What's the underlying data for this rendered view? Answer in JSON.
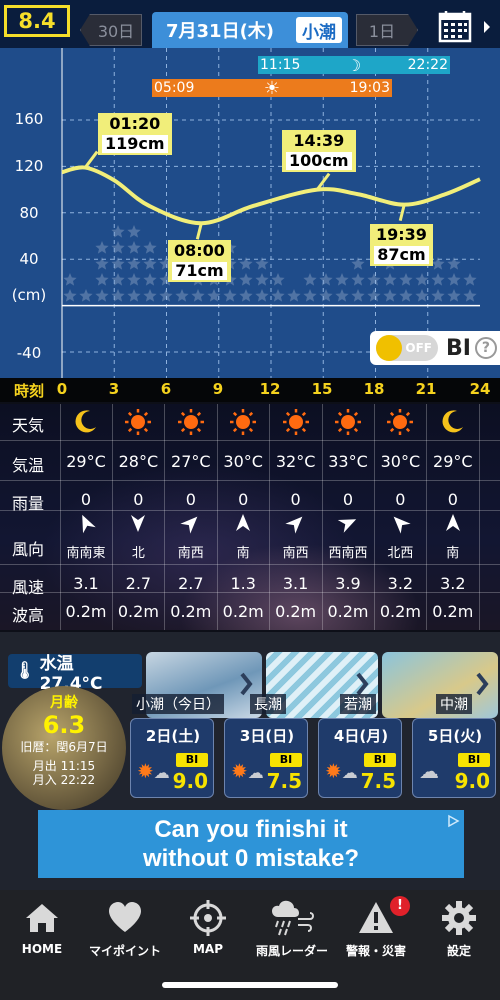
{
  "header": {
    "score_badge": "8.4",
    "prev_label": "30日",
    "date": "7月31日(木)",
    "tide_type": "小潮",
    "next_label": "1日"
  },
  "chart": {
    "moon_bar": {
      "rise": "11:15",
      "set": "22:22"
    },
    "sun_bar": {
      "rise": "05:09",
      "set": "19:03"
    },
    "yticks": [
      "160",
      "120",
      "80",
      "40",
      "(cm)",
      "-40"
    ],
    "callouts": [
      {
        "time": "01:20",
        "height": "119cm"
      },
      {
        "time": "08:00",
        "height": "71cm"
      },
      {
        "time": "14:39",
        "height": "100cm"
      },
      {
        "time": "19:39",
        "height": "87cm"
      }
    ],
    "bi_switch": "OFF",
    "bi_label": "BI",
    "help_glyph": "?"
  },
  "chart_data": {
    "type": "line",
    "title": "",
    "xlabel": "時刻",
    "ylabel": "(cm)",
    "x": [
      0,
      1.33,
      3,
      5,
      8,
      11,
      14.65,
      17,
      19.65,
      22,
      24
    ],
    "series": [
      {
        "values": [
          115,
          119,
          108,
          86,
          71,
          86,
          100,
          96,
          87,
          96,
          109
        ]
      }
    ],
    "xlim": [
      0,
      24
    ],
    "ylim": [
      -60,
      180
    ],
    "xticks": [
      "0",
      "3",
      "6",
      "9",
      "12",
      "15",
      "18",
      "21",
      "24"
    ],
    "yticks_values": [
      160,
      120,
      80,
      40,
      -40
    ],
    "extrema": [
      {
        "time": "01:20",
        "height": 119,
        "kind": "high"
      },
      {
        "time": "08:00",
        "height": 71,
        "kind": "low"
      },
      {
        "time": "14:39",
        "height": 100,
        "kind": "high"
      },
      {
        "time": "19:39",
        "height": 87,
        "kind": "low"
      }
    ],
    "grid": true,
    "line_color": "#f1ee7a"
  },
  "timerow": {
    "label": "時刻",
    "ticks": [
      "0",
      "3",
      "6",
      "9",
      "12",
      "15",
      "18",
      "21",
      "24"
    ]
  },
  "weather": {
    "row_labels": [
      "天気",
      "気温",
      "雨量",
      "風向",
      "風速",
      "波高"
    ],
    "icons": [
      "moon-icon",
      "sun-icon",
      "sun-icon",
      "sun-icon",
      "sun-icon",
      "sun-icon",
      "sun-icon",
      "moon-icon"
    ],
    "temps": [
      "29°C",
      "28°C",
      "27°C",
      "30°C",
      "32°C",
      "33°C",
      "30°C",
      "29°C"
    ],
    "rain": [
      "0",
      "0",
      "0",
      "0",
      "0",
      "0",
      "0",
      "0"
    ],
    "wind_dir": [
      "南南東",
      "北",
      "南西",
      "南",
      "南西",
      "西南西",
      "北西",
      "南"
    ],
    "wind_dir_rotation": [
      335,
      180,
      45,
      0,
      45,
      65,
      315,
      0
    ],
    "wind_speed": [
      "3.1",
      "2.7",
      "2.7",
      "1.3",
      "3.1",
      "3.9",
      "3.2",
      "3.2"
    ],
    "wave": [
      "0.2m",
      "0.2m",
      "0.2m",
      "0.2m",
      "0.2m",
      "0.2m",
      "0.2m",
      "0.2m"
    ]
  },
  "lower": {
    "water_temp": "水温 27.4°C",
    "moon_label": "月齢",
    "moon_age": "6.3",
    "lunar_date": "旧暦：閏6月7日",
    "moon_rise": "月出 11:15",
    "moon_set": "月入 22:22",
    "thumb_labels": [
      "小潮（今日）",
      "長潮",
      "若潮",
      "中潮"
    ],
    "days": [
      {
        "date": "2日(土)",
        "bi": "BI",
        "value": "9.0"
      },
      {
        "date": "3日(日)",
        "bi": "BI",
        "value": "7.5"
      },
      {
        "date": "4日(月)",
        "bi": "BI",
        "value": "7.5"
      },
      {
        "date": "5日(火)",
        "bi": "BI",
        "value": "9.0"
      }
    ]
  },
  "ad": {
    "line1": "Can you finishi it",
    "line2": "without 0 mistake?"
  },
  "tabbar": {
    "items": [
      {
        "label": "HOME"
      },
      {
        "label": "マイポイント"
      },
      {
        "label": "MAP"
      },
      {
        "label": "雨風レーダー"
      },
      {
        "label": "警報・災害"
      },
      {
        "label": "設定"
      }
    ],
    "alert_badge": "!"
  }
}
